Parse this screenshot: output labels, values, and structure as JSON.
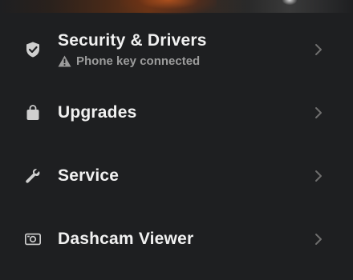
{
  "menu": {
    "items": [
      {
        "label": "Security & Drivers",
        "icon": "shield-check-icon",
        "status": {
          "icon": "warning-icon",
          "text": "Phone key connected"
        }
      },
      {
        "label": "Upgrades",
        "icon": "shopping-bag-icon"
      },
      {
        "label": "Service",
        "icon": "wrench-icon"
      },
      {
        "label": "Dashcam Viewer",
        "icon": "dashcam-icon"
      }
    ]
  },
  "colors": {
    "background": "#1e1f21",
    "text": "#f1f1f1",
    "secondary_text": "#9c9c9c",
    "chevron": "#6e6e6e"
  }
}
